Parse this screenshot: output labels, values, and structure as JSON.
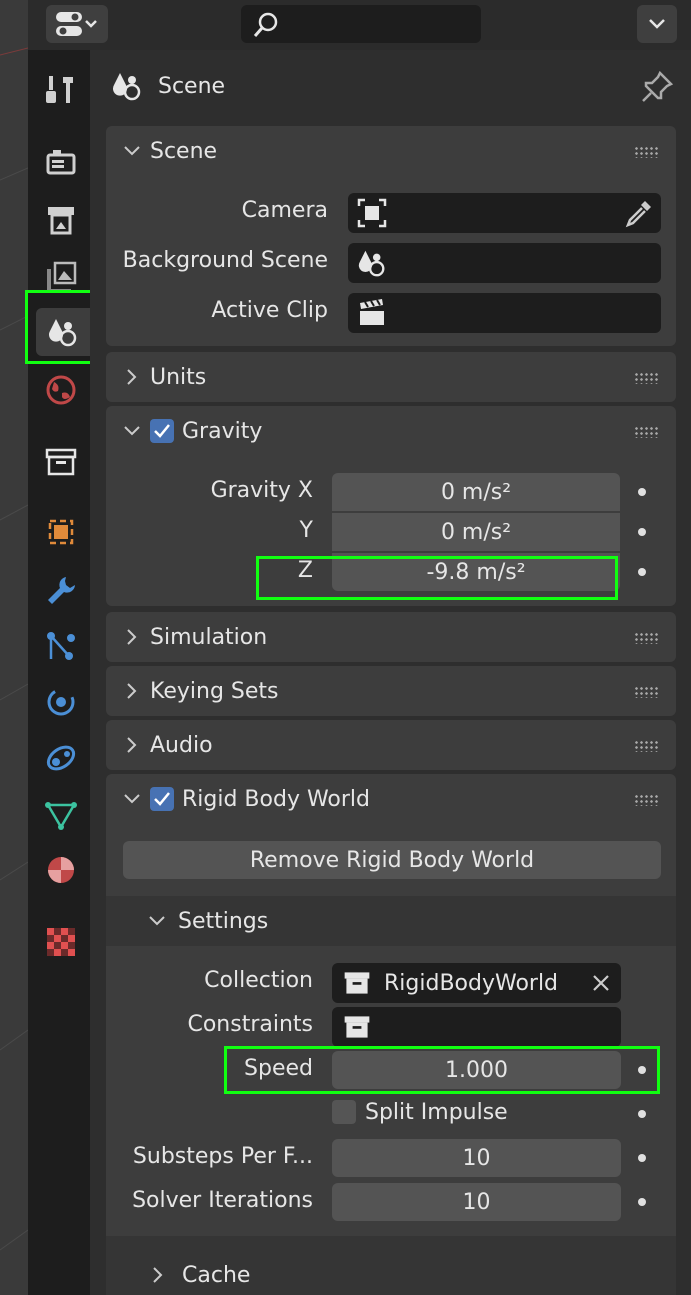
{
  "header": {
    "editor_type_icon": "properties-editor-icon",
    "search_placeholder": "",
    "dropdown_icon": "chevron-down-icon"
  },
  "tabs": [
    {
      "name": "tool",
      "icon": "tool-icon"
    },
    {
      "name": "render",
      "icon": "render-icon"
    },
    {
      "name": "output",
      "icon": "output-icon"
    },
    {
      "name": "view-layer",
      "icon": "view-layer-icon"
    },
    {
      "name": "scene",
      "icon": "scene-icon",
      "active": true
    },
    {
      "name": "world",
      "icon": "world-icon"
    },
    {
      "name": "collection",
      "icon": "collection-icon"
    },
    {
      "name": "object",
      "icon": "object-icon"
    },
    {
      "name": "modifiers",
      "icon": "wrench-icon"
    },
    {
      "name": "particles",
      "icon": "particles-icon"
    },
    {
      "name": "physics",
      "icon": "physics-icon"
    },
    {
      "name": "constraints",
      "icon": "constraints-icon"
    },
    {
      "name": "data",
      "icon": "mesh-data-icon"
    },
    {
      "name": "material",
      "icon": "material-icon"
    },
    {
      "name": "texture",
      "icon": "texture-icon"
    }
  ],
  "context": {
    "title": "Scene"
  },
  "scene_panel": {
    "title": "Scene",
    "camera_label": "Camera",
    "background_scene_label": "Background Scene",
    "active_clip_label": "Active Clip"
  },
  "units_panel": {
    "title": "Units"
  },
  "gravity_panel": {
    "title": "Gravity",
    "enabled": true,
    "x_label": "Gravity X",
    "y_label": "Y",
    "z_label": "Z",
    "x_value": "0 m/s²",
    "y_value": "0 m/s²",
    "z_value": "-9.8 m/s²"
  },
  "simulation_panel": {
    "title": "Simulation"
  },
  "keying_sets_panel": {
    "title": "Keying Sets"
  },
  "audio_panel": {
    "title": "Audio"
  },
  "rigid_body_panel": {
    "title": "Rigid Body World",
    "enabled": true,
    "remove_button": "Remove Rigid Body World",
    "settings": {
      "title": "Settings",
      "collection_label": "Collection",
      "collection_value": "RigidBodyWorld",
      "constraints_label": "Constraints",
      "constraints_value": "",
      "speed_label": "Speed",
      "speed_value": "1.000",
      "split_impulse_label": "Split Impulse",
      "split_impulse": false,
      "substeps_label": "Substeps Per F...",
      "substeps_value": "10",
      "solver_label": "Solver Iterations",
      "solver_value": "10"
    },
    "cache_title": "Cache"
  },
  "colors": {
    "accent": "#4772b3",
    "highlight": "#11ff11",
    "panel": "#3d3d3d",
    "field": "#545454"
  }
}
